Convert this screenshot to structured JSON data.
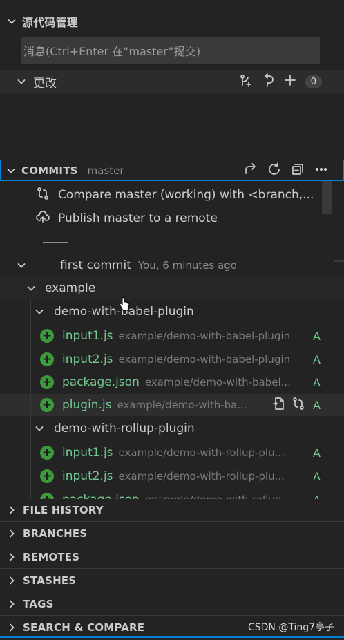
{
  "scm": {
    "title": "源代码管理",
    "message_placeholder": "消息(Ctrl+Enter 在“master”提交)",
    "changes_label": "更改",
    "changes_count": "0"
  },
  "commits": {
    "title": "COMMITS",
    "branch": "master",
    "compare_label": "Compare master (working) with <branch,...",
    "publish_label": "Publish master to a remote",
    "commit_message": "first commit",
    "commit_meta": "You, 6 minutes ago",
    "folders": {
      "example": "example",
      "babel": "demo-with-babel-plugin",
      "rollup": "demo-with-rollup-plugin"
    },
    "babel_files": [
      {
        "name": "input1.js",
        "path": "example/demo-with-babel-plugin",
        "status": "A"
      },
      {
        "name": "input2.js",
        "path": "example/demo-with-babel-plugin",
        "status": "A"
      },
      {
        "name": "package.json",
        "path": "example/demo-with-babel...",
        "status": "A"
      },
      {
        "name": "plugin.js",
        "path": "example/demo-with-ba...",
        "status": "A"
      }
    ],
    "rollup_files": [
      {
        "name": "input1.js",
        "path": "example/demo-with-rollup-plu...",
        "status": "A"
      },
      {
        "name": "input2.js",
        "path": "example/demo-with-rollup-plu...",
        "status": "A"
      },
      {
        "name": "package.json",
        "path": "example/demo-with-rollup...",
        "status": "A"
      }
    ]
  },
  "sections": [
    "FILE HISTORY",
    "BRANCHES",
    "REMOTES",
    "STASHES",
    "TAGS",
    "SEARCH & COMPARE"
  ],
  "watermark": "CSDN @Ting7亭子",
  "colors": {
    "accent": "#007fd4",
    "added": "#73c991",
    "badge": "#3c9a3c"
  }
}
